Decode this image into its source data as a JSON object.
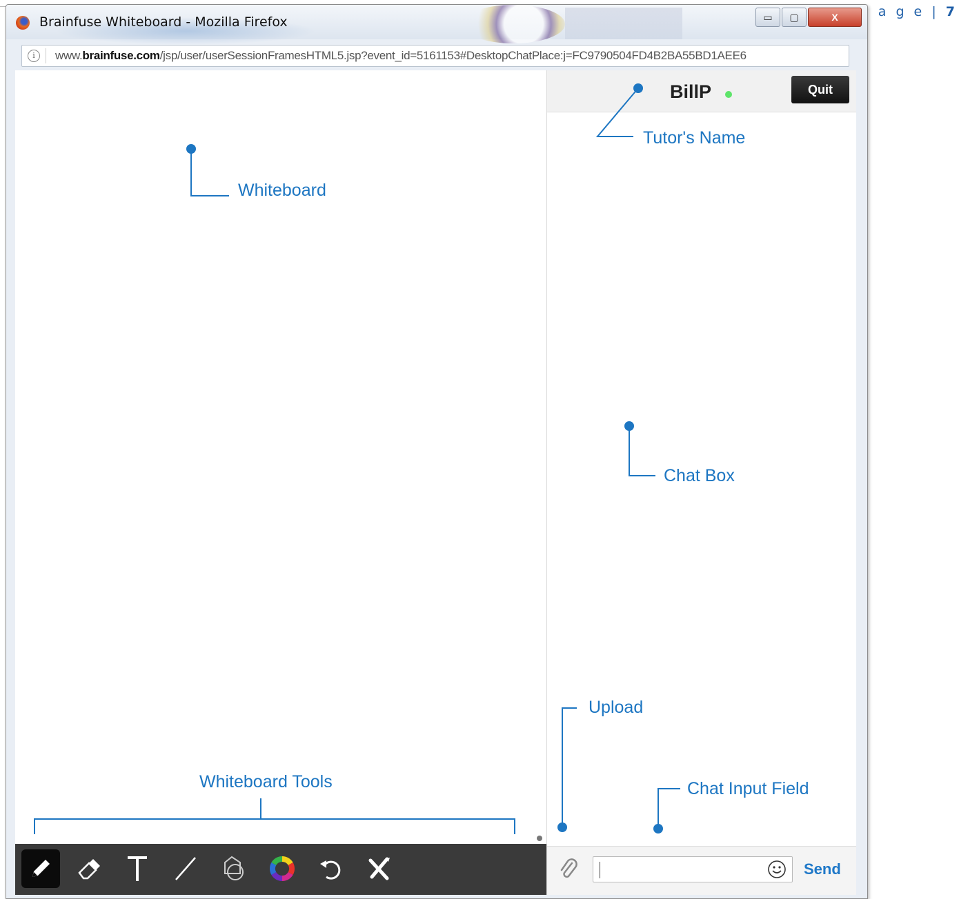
{
  "page_header": {
    "prefix": "P a g e",
    "separator": "|",
    "number": "7"
  },
  "window": {
    "title": "Brainfuse Whiteboard - Mozilla Firefox",
    "controls": {
      "minimize": "▭",
      "maximize": "▢",
      "close": "X"
    }
  },
  "address_bar": {
    "url_prefix": "www.",
    "url_domain": "brainfuse.com",
    "url_path": "/jsp/user/userSessionFramesHTML5.jsp?event_id=5161153#DesktopChatPlace:j=FC9790504FD4B2BA55BD1AEE6"
  },
  "chat": {
    "tutor_name": "BillP",
    "tutor_status": "online",
    "quit_label": "Quit",
    "input_value": "",
    "send_label": "Send"
  },
  "whiteboard_tools": [
    {
      "name": "pencil",
      "active": true
    },
    {
      "name": "eraser",
      "active": false
    },
    {
      "name": "text",
      "active": false
    },
    {
      "name": "line",
      "active": false
    },
    {
      "name": "shapes",
      "active": false
    },
    {
      "name": "color",
      "active": false
    },
    {
      "name": "undo",
      "active": false
    },
    {
      "name": "clear",
      "active": false
    }
  ],
  "annotations": {
    "whiteboard": "Whiteboard",
    "tutor_name": "Tutor's Name",
    "chat_box": "Chat Box",
    "upload": "Upload",
    "whiteboard_tools": "Whiteboard Tools",
    "chat_input_field": "Chat Input Field"
  },
  "colors": {
    "annotation": "#1d76c2",
    "send": "#1f78c8",
    "online": "#5ee46a",
    "toolbar": "#3a3a3a"
  }
}
